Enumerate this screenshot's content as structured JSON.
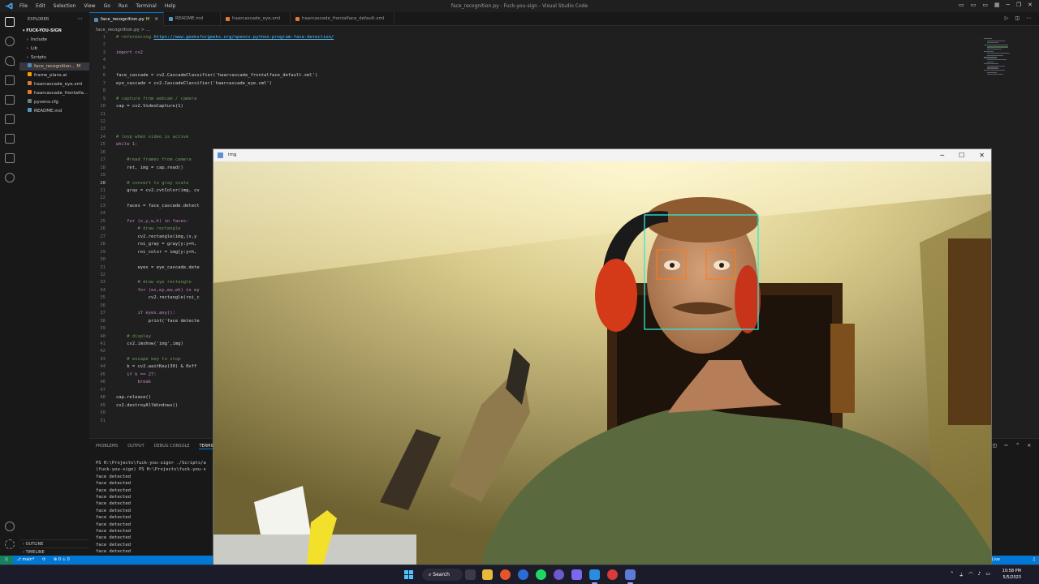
{
  "window": {
    "title": "face_recognition.py - Fuck-you-sign - Visual Studio Code",
    "menu": [
      "File",
      "Edit",
      "Selection",
      "View",
      "Go",
      "Run",
      "Terminal",
      "Help"
    ]
  },
  "sidebar": {
    "header": "EXPLORER",
    "folder": "FUCK-YOU-SIGN",
    "items": [
      {
        "label": "Include",
        "kind": "folder"
      },
      {
        "label": "Lib",
        "kind": "folder"
      },
      {
        "label": "Scripts",
        "kind": "folder"
      },
      {
        "label": "face_recognition... M",
        "kind": "py"
      },
      {
        "label": "frame_plans.ai",
        "kind": "ai"
      },
      {
        "label": "haarcascade_eye.xml",
        "kind": "xml"
      },
      {
        "label": "haarcascade_frontalfa...",
        "kind": "xml"
      },
      {
        "label": "pyvenv.cfg",
        "kind": "cfg"
      },
      {
        "label": "README.md",
        "kind": "md"
      }
    ],
    "outline": "OUTLINE",
    "timeline": "TIMELINE"
  },
  "tabs": [
    {
      "label": "face_recognition.py",
      "badge": "M",
      "active": true,
      "color": "#4b8bbe"
    },
    {
      "label": "README.md",
      "badge": "",
      "active": false,
      "color": "#519aba"
    },
    {
      "label": "haarcascade_eye.xml",
      "badge": "",
      "active": false,
      "color": "#e37933"
    },
    {
      "label": "haarcascade_frontalface_default.xml",
      "badge": "",
      "active": false,
      "color": "#e37933"
    }
  ],
  "breadcrumb": "face_recognition.py > ...",
  "code": {
    "lines": [
      {
        "n": 1,
        "t": "# referencing ",
        "link": "https://www.geeksforgeeks.org/opencv-python-program-face-detection/",
        "cls": "c-com"
      },
      {
        "n": 2,
        "t": "",
        "cls": "c-txt"
      },
      {
        "n": 3,
        "t": "import cv2",
        "cls": "c-kw"
      },
      {
        "n": 4,
        "t": "",
        "cls": "c-txt"
      },
      {
        "n": 5,
        "t": "",
        "cls": "c-txt"
      },
      {
        "n": 6,
        "t": "face_cascade = cv2.CascadeClassifier('haarcascade_frontalface_default.xml')",
        "cls": "c-txt"
      },
      {
        "n": 7,
        "t": "eye_cascade = cv2.CascadeClassifier('haarcascade_eye.xml')",
        "cls": "c-txt"
      },
      {
        "n": 8,
        "t": "",
        "cls": "c-txt"
      },
      {
        "n": 9,
        "t": "# capture from webcam / camera",
        "cls": "c-com"
      },
      {
        "n": 10,
        "t": "cap = cv2.VideoCapture(1)",
        "cls": "c-txt"
      },
      {
        "n": 11,
        "t": "",
        "cls": "c-txt"
      },
      {
        "n": 12,
        "t": "",
        "cls": "c-txt"
      },
      {
        "n": 13,
        "t": "",
        "cls": "c-txt"
      },
      {
        "n": 14,
        "t": "# loop when video is active",
        "cls": "c-com"
      },
      {
        "n": 15,
        "t": "while 1:",
        "cls": "c-kw"
      },
      {
        "n": 16,
        "t": "",
        "cls": "c-txt"
      },
      {
        "n": 17,
        "t": "    #read frames from camera",
        "cls": "c-com"
      },
      {
        "n": 18,
        "t": "    ret, img = cap.read()",
        "cls": "c-txt"
      },
      {
        "n": 19,
        "t": "",
        "cls": "c-txt"
      },
      {
        "n": 20,
        "t": "    # convert to gray scale",
        "cls": "c-com"
      },
      {
        "n": 21,
        "t": "    gray = cv2.cvtColor(img, cv",
        "cls": "c-txt"
      },
      {
        "n": 22,
        "t": "",
        "cls": "c-txt"
      },
      {
        "n": 23,
        "t": "    faces = face_cascade.detect",
        "cls": "c-txt"
      },
      {
        "n": 24,
        "t": "",
        "cls": "c-txt"
      },
      {
        "n": 25,
        "t": "    for (x,y,w,h) in faces:",
        "cls": "c-kw"
      },
      {
        "n": 26,
        "t": "        # draw rectangle",
        "cls": "c-com"
      },
      {
        "n": 27,
        "t": "        cv2.rectangle(img,(x,y",
        "cls": "c-txt"
      },
      {
        "n": 28,
        "t": "        roi_gray = gray[y:y+h,",
        "cls": "c-txt"
      },
      {
        "n": 29,
        "t": "        roi_color = img[y:y+h,",
        "cls": "c-txt"
      },
      {
        "n": 30,
        "t": "",
        "cls": "c-txt"
      },
      {
        "n": 31,
        "t": "        eyes = eye_cascade.dete",
        "cls": "c-txt"
      },
      {
        "n": 32,
        "t": "",
        "cls": "c-txt"
      },
      {
        "n": 33,
        "t": "        # draw eye rectangle",
        "cls": "c-com"
      },
      {
        "n": 34,
        "t": "        for (ex,ey,ew,eh) in ey",
        "cls": "c-kw"
      },
      {
        "n": 35,
        "t": "            cv2.rectangle(roi_c",
        "cls": "c-txt"
      },
      {
        "n": 36,
        "t": "",
        "cls": "c-txt"
      },
      {
        "n": 37,
        "t": "        if eyes.any():",
        "cls": "c-kw"
      },
      {
        "n": 38,
        "t": "            print('face detecte",
        "cls": "c-txt"
      },
      {
        "n": 39,
        "t": "",
        "cls": "c-txt"
      },
      {
        "n": 40,
        "t": "    # display",
        "cls": "c-com"
      },
      {
        "n": 41,
        "t": "    cv2.imshow('img',img)",
        "cls": "c-txt"
      },
      {
        "n": 42,
        "t": "",
        "cls": "c-txt"
      },
      {
        "n": 43,
        "t": "    # escape key to stop",
        "cls": "c-com"
      },
      {
        "n": 44,
        "t": "    k = cv2.waitKey(30) & 0xff",
        "cls": "c-txt"
      },
      {
        "n": 45,
        "t": "    if k == 27:",
        "cls": "c-kw"
      },
      {
        "n": 46,
        "t": "        break",
        "cls": "c-kw"
      },
      {
        "n": 47,
        "t": "",
        "cls": "c-txt"
      },
      {
        "n": 48,
        "t": "cap.release()",
        "cls": "c-txt"
      },
      {
        "n": 49,
        "t": "cv2.destroyAllWindows()",
        "cls": "c-txt"
      },
      {
        "n": 50,
        "t": "",
        "cls": "c-txt"
      },
      {
        "n": 51,
        "t": "",
        "cls": "c-txt"
      }
    ],
    "current_line": 20
  },
  "panel": {
    "tabs": [
      "PROBLEMS",
      "OUTPUT",
      "DEBUG CONSOLE",
      "TERMINAL"
    ],
    "active_tab": "TERMINAL",
    "terminal_lines": [
      "PS H:\\Projects\\fuck-you-sign> ./Scripts/a",
      "(fuck-you-sign) PS H:\\Projects\\fuck-you-s",
      "face detected",
      "face detected",
      "face detected",
      "face detected",
      "face detected",
      "face detected",
      "face detected",
      "face detected",
      "face detected",
      "face detected",
      "face detected",
      "face detected",
      "face detected"
    ]
  },
  "img_window": {
    "title": "img"
  },
  "statusbar": {
    "branch": "main*",
    "problems": "0 ⚠ 0",
    "golive": "Go Live"
  },
  "taskbar": {
    "search": "Search",
    "time": "10:58 PM",
    "date": "5/5/2023"
  },
  "colors": {
    "accent": "#0078d4",
    "face_box": "#2ee8d8",
    "eye_box": "#ff7a1a"
  }
}
